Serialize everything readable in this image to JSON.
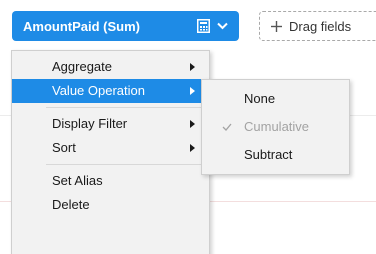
{
  "field_chip": {
    "label": "AmountPaid (Sum)",
    "icons": [
      "calculator-icon",
      "chevron-down-icon"
    ]
  },
  "drop_zone": {
    "label": "Drag fields",
    "icon": "plus-icon"
  },
  "context_menu": {
    "items": [
      {
        "label": "Aggregate",
        "has_submenu": true
      },
      {
        "label": "Value Operation",
        "has_submenu": true,
        "highlighted": true
      },
      {
        "label": "Display Filter",
        "has_submenu": true
      },
      {
        "label": "Sort",
        "has_submenu": true
      },
      {
        "label": "Set Alias",
        "has_submenu": false
      },
      {
        "label": "Delete",
        "has_submenu": false
      }
    ]
  },
  "value_operation_submenu": {
    "items": [
      {
        "label": "None",
        "enabled": true
      },
      {
        "label": "Cumulative",
        "enabled": false,
        "checked": true
      },
      {
        "label": "Subtract",
        "enabled": true
      }
    ]
  },
  "colors": {
    "accent": "#1e8be6",
    "menu_background": "#f2f2f2",
    "disabled_text": "#a3a3a3"
  }
}
